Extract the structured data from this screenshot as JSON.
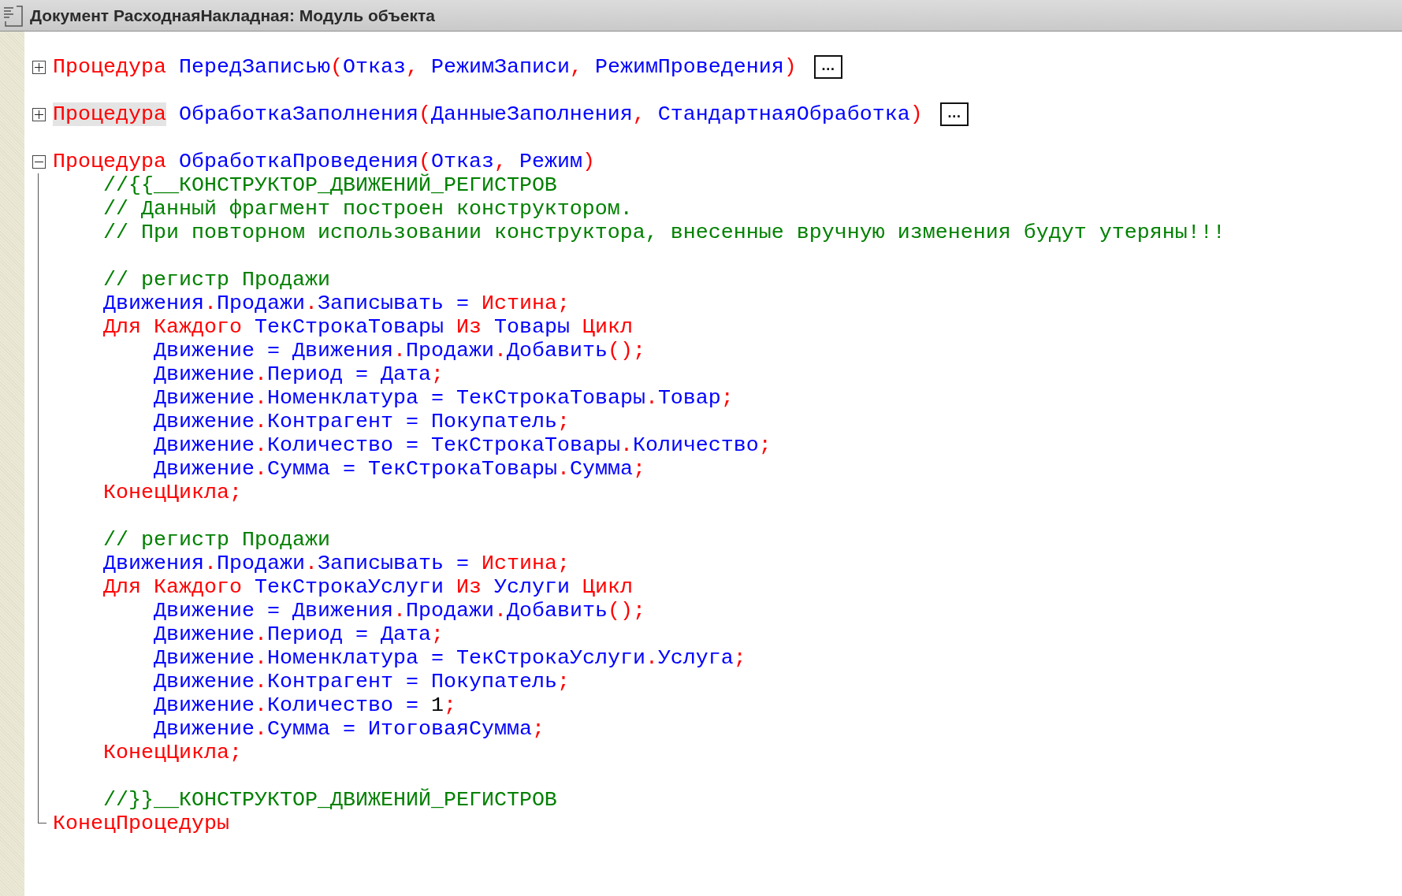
{
  "window": {
    "title": "Документ РасходнаяНакладная: Модуль объекта"
  },
  "procedures": [
    {
      "expanded": false,
      "fold_marker": "…",
      "header": [
        {
          "kind": "keyword",
          "text": "Процедура",
          "highlighted": false
        },
        {
          "kind": "identifier",
          "text": "ПередЗаписью",
          "highlighted": false
        },
        {
          "kind": "punctuation",
          "text": "(",
          "highlighted": false
        },
        {
          "kind": "identifier",
          "text": "Отказ",
          "highlighted": false
        },
        {
          "kind": "punctuation",
          "text": ", ",
          "highlighted": false
        },
        {
          "kind": "identifier",
          "text": "РежимЗаписи",
          "highlighted": false
        },
        {
          "kind": "punctuation",
          "text": ", ",
          "highlighted": false
        },
        {
          "kind": "identifier",
          "text": "РежимПроведения",
          "highlighted": false
        },
        {
          "kind": "punctuation",
          "text": ")",
          "highlighted": false
        }
      ]
    },
    {
      "expanded": false,
      "fold_marker": "…",
      "header": [
        {
          "kind": "keyword",
          "text": "Процедура",
          "highlighted": true
        },
        {
          "kind": "identifier",
          "text": "ОбработкаЗаполнения",
          "highlighted": false
        },
        {
          "kind": "punctuation",
          "text": "(",
          "highlighted": false
        },
        {
          "kind": "identifier",
          "text": "ДанныеЗаполнения",
          "highlighted": false
        },
        {
          "kind": "punctuation",
          "text": ", ",
          "highlighted": false
        },
        {
          "kind": "identifier",
          "text": "СтандартнаяОбработка",
          "highlighted": false
        },
        {
          "kind": "punctuation",
          "text": ")",
          "highlighted": false
        }
      ]
    },
    {
      "expanded": true,
      "header": [
        {
          "kind": "keyword",
          "text": "Процедура",
          "highlighted": false
        },
        {
          "kind": "identifier",
          "text": "ОбработкаПроведения",
          "highlighted": false
        },
        {
          "kind": "punctuation",
          "text": "(",
          "highlighted": false
        },
        {
          "kind": "identifier",
          "text": "Отказ",
          "highlighted": false
        },
        {
          "kind": "punctuation",
          "text": ", ",
          "highlighted": false
        },
        {
          "kind": "identifier",
          "text": "Режим",
          "highlighted": false
        },
        {
          "kind": "punctuation",
          "text": ")",
          "highlighted": false
        }
      ],
      "body": [
        {
          "kind": "code",
          "tokens": [
            {
              "kind": "comment",
              "text": "//{{__КОНСТРУКТОР_ДВИЖЕНИЙ_РЕГИСТРОВ"
            }
          ]
        },
        {
          "kind": "code",
          "tokens": [
            {
              "kind": "comment",
              "text": "// Данный фрагмент построен конструктором."
            }
          ]
        },
        {
          "kind": "code",
          "tokens": [
            {
              "kind": "comment",
              "text": "// При повторном использовании конструктора, внесенные вручную изменения будут утеряны!!!"
            }
          ]
        },
        {
          "kind": "blank"
        },
        {
          "kind": "code",
          "tokens": [
            {
              "kind": "comment",
              "text": "// регистр Продажи"
            }
          ]
        },
        {
          "kind": "code",
          "tokens": [
            {
              "kind": "identifier",
              "text": "Движения"
            },
            {
              "kind": "punctuation",
              "text": "."
            },
            {
              "kind": "identifier",
              "text": "Продажи"
            },
            {
              "kind": "punctuation",
              "text": "."
            },
            {
              "kind": "identifier",
              "text": "Записывать = "
            },
            {
              "kind": "keyword",
              "text": "Истина"
            },
            {
              "kind": "punctuation",
              "text": ";"
            }
          ]
        },
        {
          "kind": "code",
          "tokens": [
            {
              "kind": "keyword",
              "text": "Для Каждого"
            },
            {
              "kind": "identifier",
              "text": "ТекСтрокаТовары"
            },
            {
              "kind": "keyword",
              "text": "Из"
            },
            {
              "kind": "identifier",
              "text": "Товары"
            },
            {
              "kind": "keyword",
              "text": "Цикл"
            }
          ],
          "children": [
            {
              "kind": "code",
              "tokens": [
                {
                  "kind": "identifier",
                  "text": "Движение = Движения"
                },
                {
                  "kind": "punctuation",
                  "text": "."
                },
                {
                  "kind": "identifier",
                  "text": "Продажи"
                },
                {
                  "kind": "punctuation",
                  "text": "."
                },
                {
                  "kind": "identifier",
                  "text": "Добавить"
                },
                {
                  "kind": "punctuation",
                  "text": "();"
                }
              ]
            },
            {
              "kind": "code",
              "tokens": [
                {
                  "kind": "identifier",
                  "text": "Движение"
                },
                {
                  "kind": "punctuation",
                  "text": "."
                },
                {
                  "kind": "identifier",
                  "text": "Период = Дата"
                },
                {
                  "kind": "punctuation",
                  "text": ";"
                }
              ]
            },
            {
              "kind": "code",
              "tokens": [
                {
                  "kind": "identifier",
                  "text": "Движение"
                },
                {
                  "kind": "punctuation",
                  "text": "."
                },
                {
                  "kind": "identifier",
                  "text": "Номенклатура = ТекСтрокаТовары"
                },
                {
                  "kind": "punctuation",
                  "text": "."
                },
                {
                  "kind": "identifier",
                  "text": "Товар"
                },
                {
                  "kind": "punctuation",
                  "text": ";"
                }
              ]
            },
            {
              "kind": "code",
              "tokens": [
                {
                  "kind": "identifier",
                  "text": "Движение"
                },
                {
                  "kind": "punctuation",
                  "text": "."
                },
                {
                  "kind": "identifier",
                  "text": "Контрагент = Покупатель"
                },
                {
                  "kind": "punctuation",
                  "text": ";"
                }
              ]
            },
            {
              "kind": "code",
              "tokens": [
                {
                  "kind": "identifier",
                  "text": "Движение"
                },
                {
                  "kind": "punctuation",
                  "text": "."
                },
                {
                  "kind": "identifier",
                  "text": "Количество = ТекСтрокаТовары"
                },
                {
                  "kind": "punctuation",
                  "text": "."
                },
                {
                  "kind": "identifier",
                  "text": "Количество"
                },
                {
                  "kind": "punctuation",
                  "text": ";"
                }
              ]
            },
            {
              "kind": "code",
              "tokens": [
                {
                  "kind": "identifier",
                  "text": "Движение"
                },
                {
                  "kind": "punctuation",
                  "text": "."
                },
                {
                  "kind": "identifier",
                  "text": "Сумма = ТекСтрокаТовары"
                },
                {
                  "kind": "punctuation",
                  "text": "."
                },
                {
                  "kind": "identifier",
                  "text": "Сумма"
                },
                {
                  "kind": "punctuation",
                  "text": ";"
                }
              ]
            }
          ]
        },
        {
          "kind": "code",
          "tokens": [
            {
              "kind": "keyword",
              "text": "КонецЦикла"
            },
            {
              "kind": "punctuation",
              "text": ";"
            }
          ]
        },
        {
          "kind": "blank"
        },
        {
          "kind": "code",
          "tokens": [
            {
              "kind": "comment",
              "text": "// регистр Продажи"
            }
          ]
        },
        {
          "kind": "code",
          "tokens": [
            {
              "kind": "identifier",
              "text": "Движения"
            },
            {
              "kind": "punctuation",
              "text": "."
            },
            {
              "kind": "identifier",
              "text": "Продажи"
            },
            {
              "kind": "punctuation",
              "text": "."
            },
            {
              "kind": "identifier",
              "text": "Записывать = "
            },
            {
              "kind": "keyword",
              "text": "Истина"
            },
            {
              "kind": "punctuation",
              "text": ";"
            }
          ]
        },
        {
          "kind": "code",
          "tokens": [
            {
              "kind": "keyword",
              "text": "Для Каждого"
            },
            {
              "kind": "identifier",
              "text": "ТекСтрокаУслуги"
            },
            {
              "kind": "keyword",
              "text": "Из"
            },
            {
              "kind": "identifier",
              "text": "Услуги"
            },
            {
              "kind": "keyword",
              "text": "Цикл"
            }
          ],
          "children": [
            {
              "kind": "code",
              "tokens": [
                {
                  "kind": "identifier",
                  "text": "Движение = Движения"
                },
                {
                  "kind": "punctuation",
                  "text": "."
                },
                {
                  "kind": "identifier",
                  "text": "Продажи"
                },
                {
                  "kind": "punctuation",
                  "text": "."
                },
                {
                  "kind": "identifier",
                  "text": "Добавить"
                },
                {
                  "kind": "punctuation",
                  "text": "();"
                }
              ]
            },
            {
              "kind": "code",
              "tokens": [
                {
                  "kind": "identifier",
                  "text": "Движение"
                },
                {
                  "kind": "punctuation",
                  "text": "."
                },
                {
                  "kind": "identifier",
                  "text": "Период = Дата"
                },
                {
                  "kind": "punctuation",
                  "text": ";"
                }
              ]
            },
            {
              "kind": "code",
              "tokens": [
                {
                  "kind": "identifier",
                  "text": "Движение"
                },
                {
                  "kind": "punctuation",
                  "text": "."
                },
                {
                  "kind": "identifier",
                  "text": "Номенклатура = ТекСтрокаУслуги"
                },
                {
                  "kind": "punctuation",
                  "text": "."
                },
                {
                  "kind": "identifier",
                  "text": "Услуга"
                },
                {
                  "kind": "punctuation",
                  "text": ";"
                }
              ]
            },
            {
              "kind": "code",
              "tokens": [
                {
                  "kind": "identifier",
                  "text": "Движение"
                },
                {
                  "kind": "punctuation",
                  "text": "."
                },
                {
                  "kind": "identifier",
                  "text": "Контрагент = Покупатель"
                },
                {
                  "kind": "punctuation",
                  "text": ";"
                }
              ]
            },
            {
              "kind": "code",
              "tokens": [
                {
                  "kind": "identifier",
                  "text": "Движение"
                },
                {
                  "kind": "punctuation",
                  "text": "."
                },
                {
                  "kind": "identifier",
                  "text": "Количество = "
                },
                {
                  "kind": "number",
                  "text": "1"
                },
                {
                  "kind": "punctuation",
                  "text": ";"
                }
              ]
            },
            {
              "kind": "code",
              "tokens": [
                {
                  "kind": "identifier",
                  "text": "Движение"
                },
                {
                  "kind": "punctuation",
                  "text": "."
                },
                {
                  "kind": "identifier",
                  "text": "Сумма = ИтоговаяСумма"
                },
                {
                  "kind": "punctuation",
                  "text": ";"
                }
              ]
            }
          ]
        },
        {
          "kind": "code",
          "tokens": [
            {
              "kind": "keyword",
              "text": "КонецЦикла"
            },
            {
              "kind": "punctuation",
              "text": ";"
            }
          ]
        },
        {
          "kind": "blank"
        },
        {
          "kind": "code",
          "tokens": [
            {
              "kind": "comment",
              "text": "//}}__КОНСТРУКТОР_ДВИЖЕНИЙ_РЕГИСТРОВ"
            }
          ]
        }
      ],
      "footer": [
        {
          "kind": "keyword",
          "text": "КонецПроцедуры"
        }
      ]
    }
  ]
}
